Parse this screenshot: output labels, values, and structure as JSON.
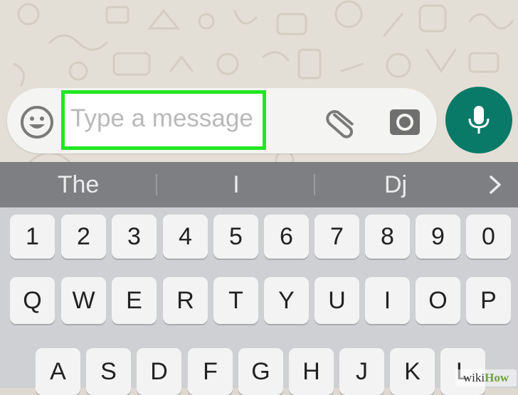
{
  "composer": {
    "placeholder": "Type a message",
    "value": ""
  },
  "highlight_color": "#22e622",
  "mic_color": "#0a7a68",
  "icons": {
    "emoji": "smiley-icon",
    "attach": "paperclip-icon",
    "camera": "camera-icon",
    "mic": "microphone-icon",
    "suggest_more": "chevron-right-icon"
  },
  "suggestions": [
    "The",
    "I",
    "Dj"
  ],
  "keys": {
    "number_row": [
      "1",
      "2",
      "3",
      "4",
      "5",
      "6",
      "7",
      "8",
      "9",
      "0"
    ],
    "top_row": [
      "Q",
      "W",
      "E",
      "R",
      "T",
      "Y",
      "U",
      "I",
      "O",
      "P"
    ],
    "middle_row": [
      "A",
      "S",
      "D",
      "F",
      "G",
      "H",
      "J",
      "K",
      "L"
    ]
  },
  "watermark": {
    "prefix": "wiki",
    "suffix": "How"
  }
}
